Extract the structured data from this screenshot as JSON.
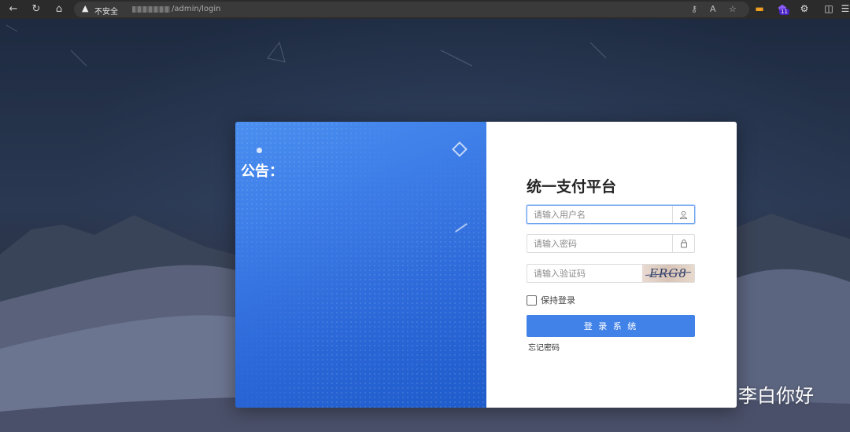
{
  "browser": {
    "insecure_label": "不安全",
    "url_path": "/admin/login",
    "extension_badge": "11"
  },
  "login_card": {
    "notice_title": "公告：",
    "system_title": "统一支付平台",
    "username_placeholder": "请输入用户名",
    "password_placeholder": "请输入密码",
    "captcha_placeholder": "请输入验证码",
    "captcha_text": "ERG8",
    "remember_label": "保持登录",
    "login_button": "登 录 系 统",
    "forgot_password": "忘记密码",
    "accent_color": "#4182e9"
  },
  "watermark": {
    "text": "李白你好"
  }
}
